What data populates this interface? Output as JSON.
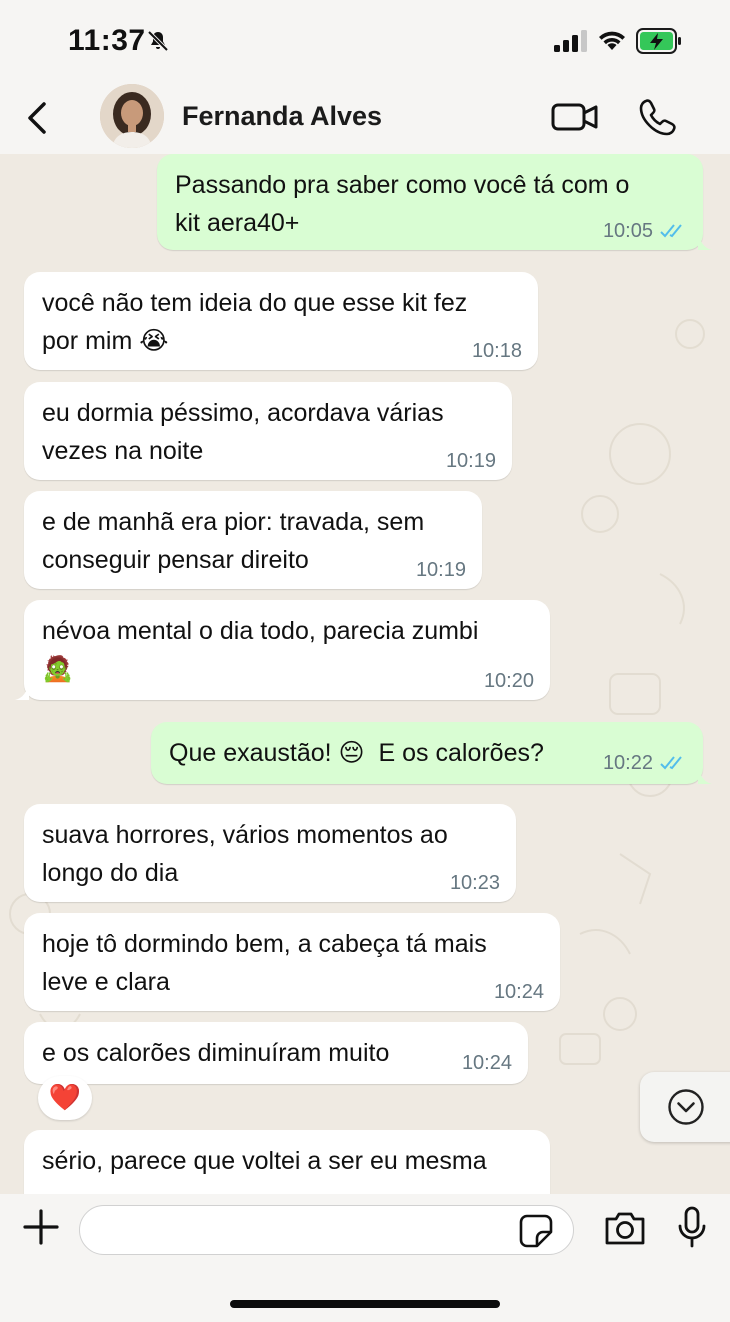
{
  "status_bar": {
    "time": "11:37",
    "icons": [
      "bell-slash-icon",
      "signal-icon",
      "wifi-icon",
      "battery-charging-icon"
    ],
    "battery_color": "#34c759"
  },
  "header": {
    "contact_name": "Fernanda Alves",
    "icons": [
      "back-arrow-icon",
      "avatar",
      "video-camera-icon",
      "phone-icon"
    ]
  },
  "colors": {
    "incoming_bubble": "#ffffff",
    "outgoing_bubble": "#d9fdd3",
    "chat_background": "#efeae2",
    "read_ticks": "#53bdeb",
    "timestamp": "#667781"
  },
  "messages": [
    {
      "direction": "out",
      "text": "Passando pra saber como você tá com o\nkit aera40+",
      "time": "10:05",
      "read": true
    },
    {
      "direction": "in",
      "text": "você não tem ideia do que esse kit fez\npor mim 😭",
      "time": "10:18"
    },
    {
      "direction": "in",
      "text": "eu dormia péssimo, acordava várias\nvezes na noite",
      "time": "10:19"
    },
    {
      "direction": "in",
      "text": "e de manhã era pior: travada, sem\nconseguir pensar direito",
      "time": "10:19"
    },
    {
      "direction": "in",
      "text": "névoa mental o dia todo, parecia zumbi\n🧟",
      "time": "10:20"
    },
    {
      "direction": "out",
      "text": "Que exaustão! 😔  E os calorões?",
      "time": "10:22",
      "read": true
    },
    {
      "direction": "in",
      "text": "suava horrores, vários momentos ao\nlongo do dia",
      "time": "10:23"
    },
    {
      "direction": "in",
      "text": "hoje tô dormindo bem, a cabeça tá mais\nleve e clara",
      "time": "10:24"
    },
    {
      "direction": "in",
      "text": "e os calorões diminuíram muito",
      "time": "10:24",
      "reaction": "❤️"
    },
    {
      "direction": "in",
      "text": "sério, parece que voltei a ser eu mesma",
      "time": ""
    }
  ],
  "input_bar": {
    "placeholder": "",
    "icons": [
      "plus-icon",
      "sticker-icon",
      "camera-icon",
      "microphone-icon"
    ]
  },
  "scroll_button_icon": "chevron-down-circle-icon"
}
